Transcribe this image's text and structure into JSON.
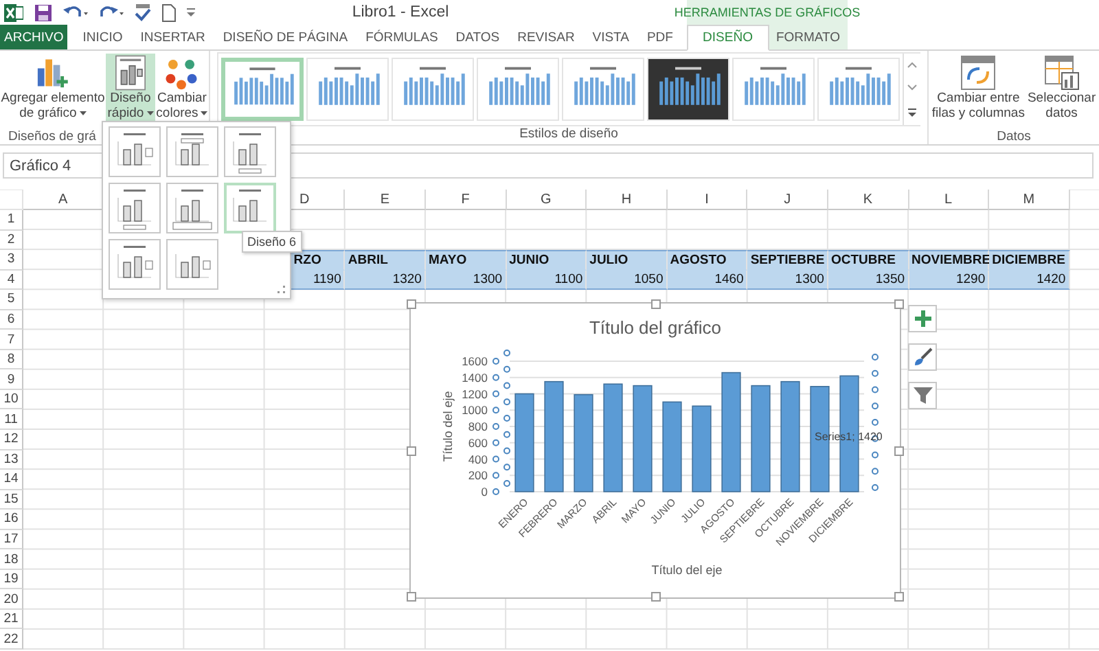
{
  "window": {
    "title": "Libro1 - Excel"
  },
  "context_tab_group": {
    "label": "HERRAMIENTAS DE GRÁFICOS"
  },
  "tabs": [
    {
      "label": "ARCHIVO",
      "kind": "file",
      "selected": false
    },
    {
      "label": "INICIO",
      "kind": "normal",
      "selected": false
    },
    {
      "label": "INSERTAR",
      "kind": "normal",
      "selected": false
    },
    {
      "label": "DISEÑO DE PÁGINA",
      "kind": "normal",
      "selected": false
    },
    {
      "label": "FÓRMULAS",
      "kind": "normal",
      "selected": false
    },
    {
      "label": "DATOS",
      "kind": "normal",
      "selected": false
    },
    {
      "label": "REVISAR",
      "kind": "normal",
      "selected": false
    },
    {
      "label": "VISTA",
      "kind": "normal",
      "selected": false
    },
    {
      "label": "PDF",
      "kind": "normal",
      "selected": false
    },
    {
      "label": "DISEÑO",
      "kind": "contextual",
      "selected": true
    },
    {
      "label": "FORMATO",
      "kind": "contextual",
      "selected": false
    }
  ],
  "ribbon": {
    "chart_layouts": {
      "label": "Diseños de grá",
      "buttons": [
        {
          "lines": [
            "Agregar elemento",
            "de gráfico"
          ],
          "kind": "add",
          "pressed": false
        },
        {
          "lines": [
            "Diseño",
            "rápido"
          ],
          "kind": "layout",
          "pressed": true
        },
        {
          "lines": [
            "Cambiar",
            "colores"
          ],
          "kind": "colors",
          "pressed": false
        }
      ]
    },
    "chart_styles": {
      "label": "Estilos de diseño",
      "styles": [
        {
          "selected": true,
          "dark": false
        },
        {
          "selected": false,
          "dark": false
        },
        {
          "selected": false,
          "dark": false
        },
        {
          "selected": false,
          "dark": false
        },
        {
          "selected": false,
          "dark": false
        },
        {
          "selected": false,
          "dark": true
        },
        {
          "selected": false,
          "dark": false
        },
        {
          "selected": false,
          "dark": false
        }
      ]
    },
    "data": {
      "label": "Datos",
      "buttons": [
        {
          "lines": [
            "Cambiar entre",
            "filas y columnas"
          ],
          "kind": "switch"
        },
        {
          "lines": [
            "Seleccionar",
            "datos"
          ],
          "kind": "select"
        }
      ]
    }
  },
  "name_box": "Gráfico 4",
  "quick_layout_menu": {
    "tooltip": "Diseño 6",
    "options": [
      {
        "selected": false
      },
      {
        "selected": false
      },
      {
        "selected": false
      },
      {
        "selected": false
      },
      {
        "selected": false
      },
      {
        "selected": true
      },
      {
        "selected": false
      },
      {
        "selected": false
      }
    ]
  },
  "sheet": {
    "columns": [
      "A",
      "D",
      "E",
      "F",
      "G",
      "H",
      "I",
      "J",
      "K",
      "L",
      "M"
    ],
    "rows": [
      "1",
      "2",
      "3",
      "4",
      "5",
      "6",
      "7",
      "8",
      "9",
      "10",
      "11",
      "12",
      "13",
      "14",
      "15",
      "16",
      "17",
      "18",
      "19",
      "20",
      "21",
      "22"
    ],
    "header_row": [
      "RZO",
      "ABRIL",
      "MAYO",
      "JUNIO",
      "JULIO",
      "AGOSTO",
      "SEPTIEBRE",
      "OCTUBRE",
      "NOVIEMBRE",
      "DICIEMBRE"
    ],
    "value_row": [
      "1190",
      "1320",
      "1300",
      "1100",
      "1050",
      "1460",
      "1300",
      "1350",
      "1290",
      "1420"
    ]
  },
  "chart": {
    "data_label": "Series1; 1420",
    "side_buttons": [
      {
        "kind": "add"
      },
      {
        "kind": "style"
      },
      {
        "kind": "filter"
      }
    ],
    "chart_data": {
      "type": "bar",
      "title": "Título del gráfico",
      "xlabel": "Título del eje",
      "ylabel": "Título del eje",
      "grid": true,
      "categories": [
        "ENERO",
        "FEBRERO",
        "MARZO",
        "ABRIL",
        "MAYO",
        "JUNIO",
        "JULIO",
        "AGOSTO",
        "SEPTIEBRE",
        "OCTUBRE",
        "NOVIEMBRE",
        "DICIEMBRE"
      ],
      "series": [
        {
          "color": "#5b9bd5",
          "values": [
            1200,
            1350,
            1190,
            1320,
            1300,
            1100,
            1050,
            1460,
            1300,
            1350,
            1290,
            1420
          ]
        }
      ],
      "ylim": [
        0,
        1600
      ],
      "yticks": [
        0,
        200,
        400,
        600,
        800,
        1000,
        1200,
        1400,
        1600
      ]
    }
  }
}
